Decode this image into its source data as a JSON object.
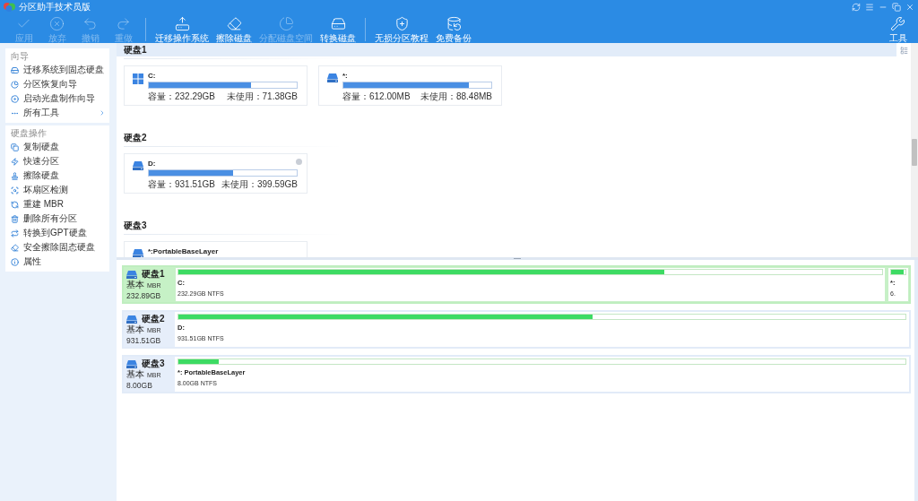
{
  "window": {
    "title": "分区助手技术员版"
  },
  "toolbar": {
    "groups": [
      [
        {
          "label": "应用",
          "disabled": true
        },
        {
          "label": "放弃",
          "disabled": true
        },
        {
          "label": "撤销",
          "disabled": true
        },
        {
          "label": "重做",
          "disabled": true
        }
      ],
      [
        {
          "label": "迁移操作系统",
          "disabled": false
        },
        {
          "label": "擦除磁盘",
          "disabled": false
        },
        {
          "label": "分配磁盘空间",
          "disabled": true
        },
        {
          "label": "转换磁盘",
          "disabled": false
        }
      ],
      [
        {
          "label": "无损分区教程",
          "disabled": false
        },
        {
          "label": "免费备份",
          "disabled": false
        }
      ]
    ],
    "tools": {
      "label": "工具"
    }
  },
  "sidebar": {
    "sections": [
      {
        "title": "向导",
        "items": [
          {
            "label": "迁移系统到固态硬盘",
            "kind": "action"
          },
          {
            "label": "分区恢复向导",
            "kind": "action"
          },
          {
            "label": "启动光盘制作向导",
            "kind": "action"
          },
          {
            "label": "所有工具",
            "kind": "submenu"
          }
        ]
      },
      {
        "title": "硬盘操作",
        "items": [
          {
            "label": "复制硬盘",
            "kind": "action"
          },
          {
            "label": "快速分区",
            "kind": "action"
          },
          {
            "label": "擦除硬盘",
            "kind": "action"
          },
          {
            "label": "坏扇区检测",
            "kind": "action"
          },
          {
            "label": "重建 MBR",
            "kind": "action"
          },
          {
            "label": "删除所有分区",
            "kind": "action"
          },
          {
            "label": "转换到GPT硬盘",
            "kind": "action"
          },
          {
            "label": "安全擦除固态硬盘",
            "kind": "action"
          },
          {
            "label": "属性",
            "kind": "action"
          }
        ]
      }
    ]
  },
  "disks": [
    {
      "title": "硬盘1",
      "pinned": true,
      "partitions": [
        {
          "kind": "system",
          "name": "C:",
          "level": 0.69,
          "capacity": "容量：232.29GB",
          "unused": "未使用：71.38GB",
          "info_icon": false
        },
        {
          "kind": "volume",
          "name": "*:",
          "level": 0.85,
          "capacity": "容量：612.00MB",
          "unused": "未使用：88.48MB",
          "info_icon": false
        }
      ]
    },
    {
      "title": "硬盘2",
      "pinned": false,
      "partitions": [
        {
          "kind": "volume",
          "name": "D:",
          "level": 0.57,
          "capacity": "容量：931.51GB",
          "unused": "未使用：399.59GB",
          "info_icon": true
        }
      ]
    },
    {
      "title": "硬盘3",
      "pinned": false,
      "partitions": [
        {
          "kind": "volume",
          "name": "*:PortableBaseLayer",
          "info_icon": false
        }
      ]
    }
  ],
  "disk_map": [
    {
      "title": "硬盘1",
      "type": "基本",
      "style": "MBR",
      "size": "232.89GB",
      "selected": true,
      "partitions": [
        {
          "kind": "wide",
          "name": "C:",
          "info": "232.29GB NTFS",
          "level": 0.69
        },
        {
          "kind": "narrow",
          "name": "*:",
          "info": "6.",
          "level": 0.85
        }
      ]
    },
    {
      "title": "硬盘2",
      "type": "基本",
      "style": "MBR",
      "size": "931.51GB",
      "selected": false,
      "partitions": [
        {
          "kind": "wide",
          "name": "D:",
          "info": "931.51GB NTFS",
          "level": 0.57
        }
      ]
    },
    {
      "title": "硬盘3",
      "type": "基本",
      "style": "MBR",
      "size": "8.00GB",
      "selected": false,
      "partitions": [
        {
          "kind": "wide",
          "name": "*: PortableBaseLayer",
          "info": "8.00GB NTFS",
          "level": 0.055
        }
      ]
    }
  ]
}
